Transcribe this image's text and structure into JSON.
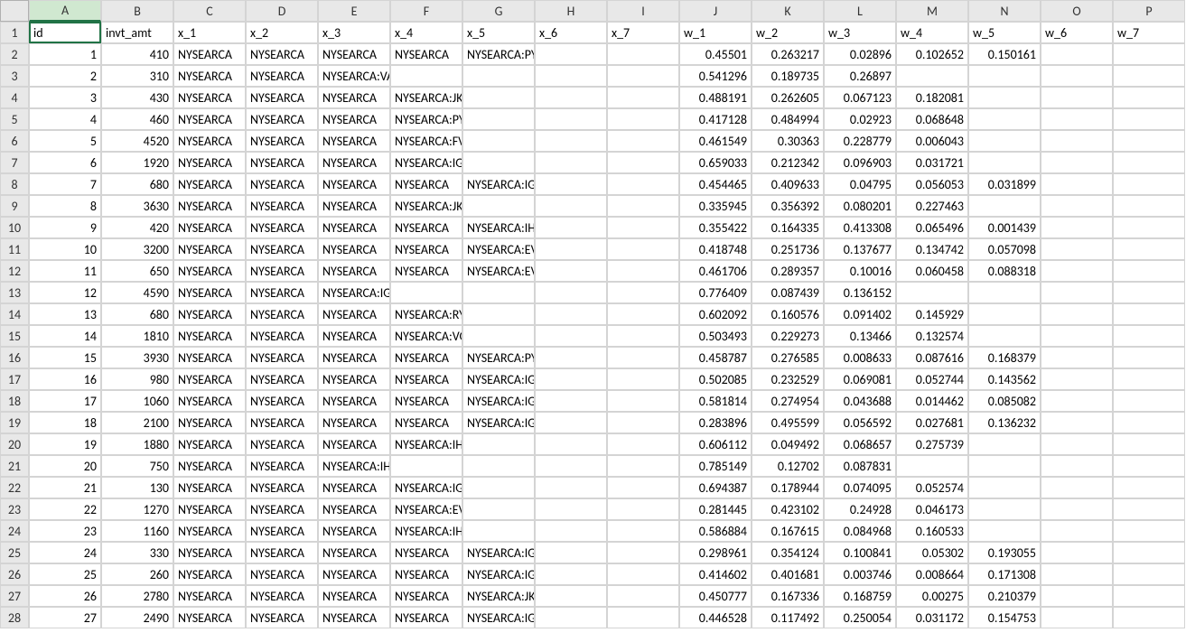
{
  "columns": [
    "A",
    "B",
    "C",
    "D",
    "E",
    "F",
    "G",
    "H",
    "I",
    "J",
    "K",
    "L",
    "M",
    "N",
    "O",
    "P"
  ],
  "selected_cell": "A1",
  "header_row": [
    "id",
    "invt_amt",
    "x_1",
    "x_2",
    "x_3",
    "x_4",
    "x_5",
    "x_6",
    "x_7",
    "w_1",
    "w_2",
    "w_3",
    "w_4",
    "w_5",
    "w_6",
    "w_7"
  ],
  "rows": [
    {
      "n": 1,
      "id": "1",
      "amt": "410",
      "x": [
        "NYSEARCA",
        "NYSEARCA",
        "NYSEARCA",
        "NYSEARCA",
        "NYSEARCA:PYZ",
        "",
        ""
      ],
      "w": [
        "0.45501",
        "0.263217",
        "0.02896",
        "0.102652",
        "0.150161",
        "",
        ""
      ]
    },
    {
      "n": 2,
      "id": "2",
      "amt": "310",
      "x": [
        "NYSEARCA",
        "NYSEARCA",
        "NYSEARCA:VAW",
        "",
        "",
        "",
        ""
      ],
      "w": [
        "0.541296",
        "0.189735",
        "0.26897",
        "",
        "",
        "",
        ""
      ]
    },
    {
      "n": 3,
      "id": "3",
      "amt": "430",
      "x": [
        "NYSEARCA",
        "NYSEARCA",
        "NYSEARCA",
        "NYSEARCA:JKH",
        "",
        "",
        ""
      ],
      "w": [
        "0.488191",
        "0.262605",
        "0.067123",
        "0.182081",
        "",
        "",
        ""
      ]
    },
    {
      "n": 4,
      "id": "4",
      "amt": "460",
      "x": [
        "NYSEARCA",
        "NYSEARCA",
        "NYSEARCA",
        "NYSEARCA:PYZ",
        "",
        "",
        ""
      ],
      "w": [
        "0.417128",
        "0.484994",
        "0.02923",
        "0.068648",
        "",
        "",
        ""
      ]
    },
    {
      "n": 5,
      "id": "5",
      "amt": "4520",
      "x": [
        "NYSEARCA",
        "NYSEARCA",
        "NYSEARCA",
        "NYSEARCA:FVL",
        "",
        "",
        ""
      ],
      "w": [
        "0.461549",
        "0.30363",
        "0.228779",
        "0.006043",
        "",
        "",
        ""
      ]
    },
    {
      "n": 6,
      "id": "6",
      "amt": "1920",
      "x": [
        "NYSEARCA",
        "NYSEARCA",
        "NYSEARCA",
        "NYSEARCA:IGM",
        "",
        "",
        ""
      ],
      "w": [
        "0.659033",
        "0.212342",
        "0.096903",
        "0.031721",
        "",
        "",
        ""
      ]
    },
    {
      "n": 7,
      "id": "7",
      "amt": "680",
      "x": [
        "NYSEARCA",
        "NYSEARCA",
        "NYSEARCA",
        "NYSEARCA",
        "NYSEARCA:IGM",
        "",
        ""
      ],
      "w": [
        "0.454465",
        "0.409633",
        "0.04795",
        "0.056053",
        "0.031899",
        "",
        ""
      ]
    },
    {
      "n": 8,
      "id": "8",
      "amt": "3630",
      "x": [
        "NYSEARCA",
        "NYSEARCA",
        "NYSEARCA",
        "NYSEARCA:JKH",
        "",
        "",
        ""
      ],
      "w": [
        "0.335945",
        "0.356392",
        "0.080201",
        "0.227463",
        "",
        "",
        ""
      ]
    },
    {
      "n": 9,
      "id": "9",
      "amt": "420",
      "x": [
        "NYSEARCA",
        "NYSEARCA",
        "NYSEARCA",
        "NYSEARCA",
        "NYSEARCA:IHF",
        "",
        ""
      ],
      "w": [
        "0.355422",
        "0.164335",
        "0.413308",
        "0.065496",
        "0.001439",
        "",
        ""
      ]
    },
    {
      "n": 10,
      "id": "10",
      "amt": "3200",
      "x": [
        "NYSEARCA",
        "NYSEARCA",
        "NYSEARCA",
        "NYSEARCA",
        "NYSEARCA:EVX",
        "",
        ""
      ],
      "w": [
        "0.418748",
        "0.251736",
        "0.137677",
        "0.134742",
        "0.057098",
        "",
        ""
      ]
    },
    {
      "n": 11,
      "id": "11",
      "amt": "650",
      "x": [
        "NYSEARCA",
        "NYSEARCA",
        "NYSEARCA",
        "NYSEARCA",
        "NYSEARCA:EVX",
        "",
        ""
      ],
      "w": [
        "0.461706",
        "0.289357",
        "0.10016",
        "0.060458",
        "0.088318",
        "",
        ""
      ]
    },
    {
      "n": 12,
      "id": "12",
      "amt": "4590",
      "x": [
        "NYSEARCA",
        "NYSEARCA",
        "NYSEARCA:IGM",
        "",
        "",
        "",
        ""
      ],
      "w": [
        "0.776409",
        "0.087439",
        "0.136152",
        "",
        "",
        "",
        ""
      ]
    },
    {
      "n": 13,
      "id": "13",
      "amt": "680",
      "x": [
        "NYSEARCA",
        "NYSEARCA",
        "NYSEARCA",
        "NYSEARCA:RYH",
        "",
        "",
        ""
      ],
      "w": [
        "0.602092",
        "0.160576",
        "0.091402",
        "0.145929",
        "",
        "",
        ""
      ]
    },
    {
      "n": 14,
      "id": "14",
      "amt": "1810",
      "x": [
        "NYSEARCA",
        "NYSEARCA",
        "NYSEARCA",
        "NYSEARCA:VOT",
        "",
        "",
        ""
      ],
      "w": [
        "0.503493",
        "0.229273",
        "0.13466",
        "0.132574",
        "",
        "",
        ""
      ]
    },
    {
      "n": 15,
      "id": "15",
      "amt": "3930",
      "x": [
        "NYSEARCA",
        "NYSEARCA",
        "NYSEARCA",
        "NYSEARCA",
        "NYSEARCA:PYZ",
        "",
        ""
      ],
      "w": [
        "0.458787",
        "0.276585",
        "0.008633",
        "0.087616",
        "0.168379",
        "",
        ""
      ]
    },
    {
      "n": 16,
      "id": "16",
      "amt": "980",
      "x": [
        "NYSEARCA",
        "NYSEARCA",
        "NYSEARCA",
        "NYSEARCA",
        "NYSEARCA:IGM",
        "",
        ""
      ],
      "w": [
        "0.502085",
        "0.232529",
        "0.069081",
        "0.052744",
        "0.143562",
        "",
        ""
      ]
    },
    {
      "n": 17,
      "id": "17",
      "amt": "1060",
      "x": [
        "NYSEARCA",
        "NYSEARCA",
        "NYSEARCA",
        "NYSEARCA",
        "NYSEARCA:IGM",
        "",
        ""
      ],
      "w": [
        "0.581814",
        "0.274954",
        "0.043688",
        "0.014462",
        "0.085082",
        "",
        ""
      ]
    },
    {
      "n": 18,
      "id": "18",
      "amt": "2100",
      "x": [
        "NYSEARCA",
        "NYSEARCA",
        "NYSEARCA",
        "NYSEARCA",
        "NYSEARCA:IGM",
        "",
        ""
      ],
      "w": [
        "0.283896",
        "0.495599",
        "0.056592",
        "0.027681",
        "0.136232",
        "",
        ""
      ]
    },
    {
      "n": 19,
      "id": "19",
      "amt": "1880",
      "x": [
        "NYSEARCA",
        "NYSEARCA",
        "NYSEARCA",
        "NYSEARCA:IHF",
        "",
        "",
        ""
      ],
      "w": [
        "0.606112",
        "0.049492",
        "0.068657",
        "0.275739",
        "",
        "",
        ""
      ]
    },
    {
      "n": 20,
      "id": "20",
      "amt": "750",
      "x": [
        "NYSEARCA",
        "NYSEARCA",
        "NYSEARCA:IHF",
        "",
        "",
        "",
        ""
      ],
      "w": [
        "0.785149",
        "0.12702",
        "0.087831",
        "",
        "",
        "",
        ""
      ]
    },
    {
      "n": 21,
      "id": "21",
      "amt": "130",
      "x": [
        "NYSEARCA",
        "NYSEARCA",
        "NYSEARCA",
        "NYSEARCA:IGM",
        "",
        "",
        ""
      ],
      "w": [
        "0.694387",
        "0.178944",
        "0.074095",
        "0.052574",
        "",
        "",
        ""
      ]
    },
    {
      "n": 22,
      "id": "22",
      "amt": "1270",
      "x": [
        "NYSEARCA",
        "NYSEARCA",
        "NYSEARCA",
        "NYSEARCA:EVX",
        "",
        "",
        ""
      ],
      "w": [
        "0.281445",
        "0.423102",
        "0.24928",
        "0.046173",
        "",
        "",
        ""
      ]
    },
    {
      "n": 23,
      "id": "23",
      "amt": "1160",
      "x": [
        "NYSEARCA",
        "NYSEARCA",
        "NYSEARCA",
        "NYSEARCA:IHF",
        "",
        "",
        ""
      ],
      "w": [
        "0.586884",
        "0.167615",
        "0.084968",
        "0.160533",
        "",
        "",
        ""
      ]
    },
    {
      "n": 24,
      "id": "24",
      "amt": "330",
      "x": [
        "NYSEARCA",
        "NYSEARCA",
        "NYSEARCA",
        "NYSEARCA",
        "NYSEARCA:IGV",
        "",
        ""
      ],
      "w": [
        "0.298961",
        "0.354124",
        "0.100841",
        "0.05302",
        "0.193055",
        "",
        ""
      ]
    },
    {
      "n": 25,
      "id": "25",
      "amt": "260",
      "x": [
        "NYSEARCA",
        "NYSEARCA",
        "NYSEARCA",
        "NYSEARCA",
        "NYSEARCA:IGV",
        "",
        ""
      ],
      "w": [
        "0.414602",
        "0.401681",
        "0.003746",
        "0.008664",
        "0.171308",
        "",
        ""
      ]
    },
    {
      "n": 26,
      "id": "26",
      "amt": "2780",
      "x": [
        "NYSEARCA",
        "NYSEARCA",
        "NYSEARCA",
        "NYSEARCA",
        "NYSEARCA:JKH",
        "",
        ""
      ],
      "w": [
        "0.450777",
        "0.167336",
        "0.168759",
        "0.00275",
        "0.210379",
        "",
        ""
      ]
    },
    {
      "n": 27,
      "id": "27",
      "amt": "2490",
      "x": [
        "NYSEARCA",
        "NYSEARCA",
        "NYSEARCA",
        "NYSEARCA",
        "NYSEARCA:IGV",
        "",
        ""
      ],
      "w": [
        "0.446528",
        "0.117492",
        "0.250054",
        "0.031172",
        "0.154753",
        "",
        ""
      ]
    }
  ]
}
